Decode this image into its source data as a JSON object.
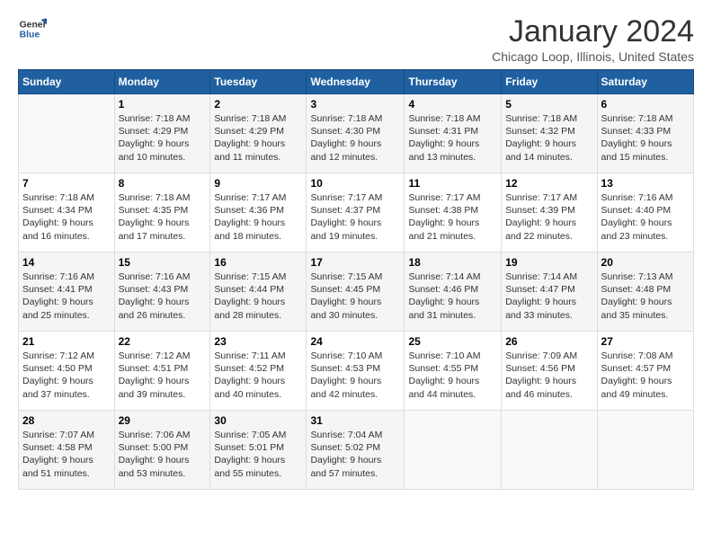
{
  "logo": {
    "general": "General",
    "blue": "Blue"
  },
  "title": "January 2024",
  "subtitle": "Chicago Loop, Illinois, United States",
  "days_header": [
    "Sunday",
    "Monday",
    "Tuesday",
    "Wednesday",
    "Thursday",
    "Friday",
    "Saturday"
  ],
  "weeks": [
    [
      {
        "day": "",
        "info": ""
      },
      {
        "day": "1",
        "info": "Sunrise: 7:18 AM\nSunset: 4:29 PM\nDaylight: 9 hours\nand 10 minutes."
      },
      {
        "day": "2",
        "info": "Sunrise: 7:18 AM\nSunset: 4:29 PM\nDaylight: 9 hours\nand 11 minutes."
      },
      {
        "day": "3",
        "info": "Sunrise: 7:18 AM\nSunset: 4:30 PM\nDaylight: 9 hours\nand 12 minutes."
      },
      {
        "day": "4",
        "info": "Sunrise: 7:18 AM\nSunset: 4:31 PM\nDaylight: 9 hours\nand 13 minutes."
      },
      {
        "day": "5",
        "info": "Sunrise: 7:18 AM\nSunset: 4:32 PM\nDaylight: 9 hours\nand 14 minutes."
      },
      {
        "day": "6",
        "info": "Sunrise: 7:18 AM\nSunset: 4:33 PM\nDaylight: 9 hours\nand 15 minutes."
      }
    ],
    [
      {
        "day": "7",
        "info": "Sunrise: 7:18 AM\nSunset: 4:34 PM\nDaylight: 9 hours\nand 16 minutes."
      },
      {
        "day": "8",
        "info": "Sunrise: 7:18 AM\nSunset: 4:35 PM\nDaylight: 9 hours\nand 17 minutes."
      },
      {
        "day": "9",
        "info": "Sunrise: 7:17 AM\nSunset: 4:36 PM\nDaylight: 9 hours\nand 18 minutes."
      },
      {
        "day": "10",
        "info": "Sunrise: 7:17 AM\nSunset: 4:37 PM\nDaylight: 9 hours\nand 19 minutes."
      },
      {
        "day": "11",
        "info": "Sunrise: 7:17 AM\nSunset: 4:38 PM\nDaylight: 9 hours\nand 21 minutes."
      },
      {
        "day": "12",
        "info": "Sunrise: 7:17 AM\nSunset: 4:39 PM\nDaylight: 9 hours\nand 22 minutes."
      },
      {
        "day": "13",
        "info": "Sunrise: 7:16 AM\nSunset: 4:40 PM\nDaylight: 9 hours\nand 23 minutes."
      }
    ],
    [
      {
        "day": "14",
        "info": "Sunrise: 7:16 AM\nSunset: 4:41 PM\nDaylight: 9 hours\nand 25 minutes."
      },
      {
        "day": "15",
        "info": "Sunrise: 7:16 AM\nSunset: 4:43 PM\nDaylight: 9 hours\nand 26 minutes."
      },
      {
        "day": "16",
        "info": "Sunrise: 7:15 AM\nSunset: 4:44 PM\nDaylight: 9 hours\nand 28 minutes."
      },
      {
        "day": "17",
        "info": "Sunrise: 7:15 AM\nSunset: 4:45 PM\nDaylight: 9 hours\nand 30 minutes."
      },
      {
        "day": "18",
        "info": "Sunrise: 7:14 AM\nSunset: 4:46 PM\nDaylight: 9 hours\nand 31 minutes."
      },
      {
        "day": "19",
        "info": "Sunrise: 7:14 AM\nSunset: 4:47 PM\nDaylight: 9 hours\nand 33 minutes."
      },
      {
        "day": "20",
        "info": "Sunrise: 7:13 AM\nSunset: 4:48 PM\nDaylight: 9 hours\nand 35 minutes."
      }
    ],
    [
      {
        "day": "21",
        "info": "Sunrise: 7:12 AM\nSunset: 4:50 PM\nDaylight: 9 hours\nand 37 minutes."
      },
      {
        "day": "22",
        "info": "Sunrise: 7:12 AM\nSunset: 4:51 PM\nDaylight: 9 hours\nand 39 minutes."
      },
      {
        "day": "23",
        "info": "Sunrise: 7:11 AM\nSunset: 4:52 PM\nDaylight: 9 hours\nand 40 minutes."
      },
      {
        "day": "24",
        "info": "Sunrise: 7:10 AM\nSunset: 4:53 PM\nDaylight: 9 hours\nand 42 minutes."
      },
      {
        "day": "25",
        "info": "Sunrise: 7:10 AM\nSunset: 4:55 PM\nDaylight: 9 hours\nand 44 minutes."
      },
      {
        "day": "26",
        "info": "Sunrise: 7:09 AM\nSunset: 4:56 PM\nDaylight: 9 hours\nand 46 minutes."
      },
      {
        "day": "27",
        "info": "Sunrise: 7:08 AM\nSunset: 4:57 PM\nDaylight: 9 hours\nand 49 minutes."
      }
    ],
    [
      {
        "day": "28",
        "info": "Sunrise: 7:07 AM\nSunset: 4:58 PM\nDaylight: 9 hours\nand 51 minutes."
      },
      {
        "day": "29",
        "info": "Sunrise: 7:06 AM\nSunset: 5:00 PM\nDaylight: 9 hours\nand 53 minutes."
      },
      {
        "day": "30",
        "info": "Sunrise: 7:05 AM\nSunset: 5:01 PM\nDaylight: 9 hours\nand 55 minutes."
      },
      {
        "day": "31",
        "info": "Sunrise: 7:04 AM\nSunset: 5:02 PM\nDaylight: 9 hours\nand 57 minutes."
      },
      {
        "day": "",
        "info": ""
      },
      {
        "day": "",
        "info": ""
      },
      {
        "day": "",
        "info": ""
      }
    ]
  ]
}
